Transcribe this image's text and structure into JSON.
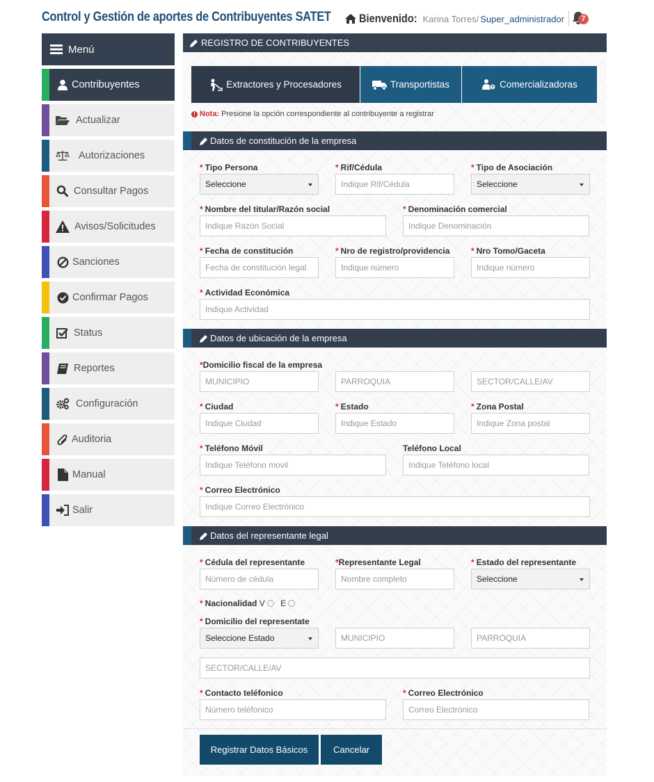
{
  "header": {
    "app_title": "Control y Gestión de aportes de Contribuyentes SATET",
    "welcome": "Bienvenido:",
    "user_name": "Karina Torres/",
    "user_role": "Super_administrador",
    "notifications": "7"
  },
  "sidebar": {
    "menu_label": "Menú",
    "items": [
      {
        "label": "Contribuyentes",
        "icon": "user-icon",
        "color": "#27ae60"
      },
      {
        "label": "Actualizar",
        "icon": "folder-open-icon",
        "color": "#6f4e9c"
      },
      {
        "label": "Autorizaciones",
        "icon": "scale-icon",
        "color": "#1d5b80"
      },
      {
        "label": "Consultar Pagos",
        "icon": "search-icon",
        "color": "#e8553a"
      },
      {
        "label": "Avisos/Solicitudes",
        "icon": "warning-icon",
        "color": "#d7263d"
      },
      {
        "label": "Sanciones",
        "icon": "ban-icon",
        "color": "#3f51b5"
      },
      {
        "label": "Confirmar Pagos",
        "icon": "check-circle-icon",
        "color": "#f4c20d"
      },
      {
        "label": "Status",
        "icon": "check-square-icon",
        "color": "#27ae60"
      },
      {
        "label": "Reportes",
        "icon": "book-icon",
        "color": "#6f4e9c"
      },
      {
        "label": "Configuración",
        "icon": "gears-icon",
        "color": "#1d5b80"
      },
      {
        "label": "Auditoria",
        "icon": "paperclip-icon",
        "color": "#e8553a"
      },
      {
        "label": "Manual",
        "icon": "file-icon",
        "color": "#d7263d"
      },
      {
        "label": "Salir",
        "icon": "sign-in-icon",
        "color": "#3f51b5"
      }
    ]
  },
  "main": {
    "title": "REGISTRO DE CONTRIBUYENTES",
    "tabs": [
      "Extractores y Procesadores",
      "Transportistas",
      "Comercializadoras"
    ],
    "note_label": "Nota:",
    "note_text": "Presione la opción correspondiente al contribuyente a registrar",
    "sections": {
      "constitucion": "Datos de constitución de la empresa",
      "ubicacion": "Datos de ubicación de la empresa",
      "representante": "Datos del representante legal"
    },
    "labels": {
      "tipo_persona": "Tipo Persona",
      "rif": "Rif/Cédula",
      "tipo_asociacion": "Tipo de Asociación",
      "nombre_titular": "Nombre del titular/Razón social",
      "denominacion": "Denominación comercial",
      "fecha_constitucion": "Fecha de constitución",
      "nro_registro": "Nro de registro/providencia",
      "nro_tomo": "Nro Tomo/Gaceta",
      "actividad": "Actividad Económica",
      "domicilio_fiscal": "Domicilio fiscal de la empresa",
      "ciudad": "Ciudad",
      "estado": "Estado",
      "zona_postal": "Zona Postal",
      "tel_movil": "Teléfono Móvil",
      "tel_local": "Teléfono Local",
      "correo": "Correo Electrónico",
      "cedula_rep": "Cédula del representante",
      "rep_legal": "Representante Legal",
      "estado_rep": "Estado del representante",
      "nacionalidad": "Nacionalidad",
      "nac_v": "V",
      "nac_e": "E",
      "domicilio_rep": "Domicilio del representate",
      "contacto_tel": "Contacto teléfonico",
      "correo_rep": "Correo Electrónico"
    },
    "fields": {
      "tipo_persona": "Seleccione",
      "rif": "Indique Rif/Cédula",
      "tipo_asociacion": "Seleccione",
      "nombre_titular": "Indique Razón Social",
      "denominacion": "Indique Denominación",
      "fecha_constitucion": "Fecha de constitución legal",
      "nro_registro": "Indique número",
      "nro_tomo": "Indique número",
      "actividad": "Indique Actividad",
      "municipio": "MUNICIPIO",
      "parroquia": "PARROQUIA",
      "sector": "SECTOR/CALLE/AV",
      "ciudad": "Indique Ciudad",
      "estado": "Indique Estado",
      "zona_postal": "Indique Zona postal",
      "tel_movil": "Indique Teléfono movil",
      "tel_local": "Indique Teléfono local",
      "correo": "Indique Correo Electrónico",
      "cedula_rep": "Número de cédula",
      "rep_legal": "Nombre completo",
      "estado_rep": "Seleccione",
      "estado_dom_rep": "Seleccione Estado",
      "municipio_rep": "MUNICIPIO",
      "parroquia_rep": "PARROQUIA",
      "sector_rep": "SECTOR/CALLE/AV",
      "contacto_tel": "Número teléfonico",
      "correo_rep": "Correo Electrónico"
    },
    "buttons": {
      "submit": "Registrar Datos Básicos",
      "cancel": "Cancelar"
    }
  }
}
